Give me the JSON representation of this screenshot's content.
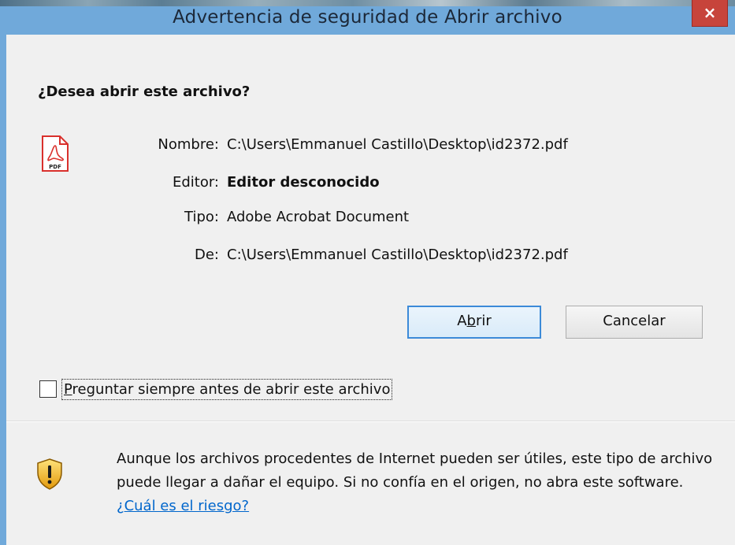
{
  "window": {
    "title": "Advertencia de seguridad de Abrir archivo",
    "close_label": "×"
  },
  "dialog": {
    "question": "¿Desea abrir este archivo?",
    "file_icon": "pdf-file-icon",
    "fields": [
      {
        "label": "Nombre:",
        "value": "C:\\Users\\Emmanuel Castillo\\Desktop\\id2372.pdf"
      },
      {
        "label": "Editor:",
        "value": "Editor desconocido"
      },
      {
        "label": "Tipo:",
        "value": "Adobe Acrobat Document"
      },
      {
        "label": "De:",
        "value": "C:\\Users\\Emmanuel Castillo\\Desktop\\id2372.pdf"
      }
    ],
    "buttons": {
      "open_pre": "A",
      "open_mnemonic": "b",
      "open_post": "rir",
      "cancel": "Cancelar"
    },
    "checkbox": {
      "checked": false,
      "mnemonic": "P",
      "label_rest": "reguntar siempre antes de abrir este archivo"
    },
    "warning": {
      "icon": "shield-warning-icon",
      "text": "Aunque los archivos procedentes de Internet pueden ser útiles, este tipo de archivo puede llegar a dañar el equipo. Si no confía en el origen, no abra este software.",
      "link_mnemonic": "¿",
      "link_rest": "Cuál es el riesgo?"
    }
  },
  "colors": {
    "title_bar": "#70a9da",
    "close_button": "#c7443b",
    "client_bg": "#f0f0f0",
    "link": "#0066cc",
    "primary_border": "#3c8ad8"
  }
}
